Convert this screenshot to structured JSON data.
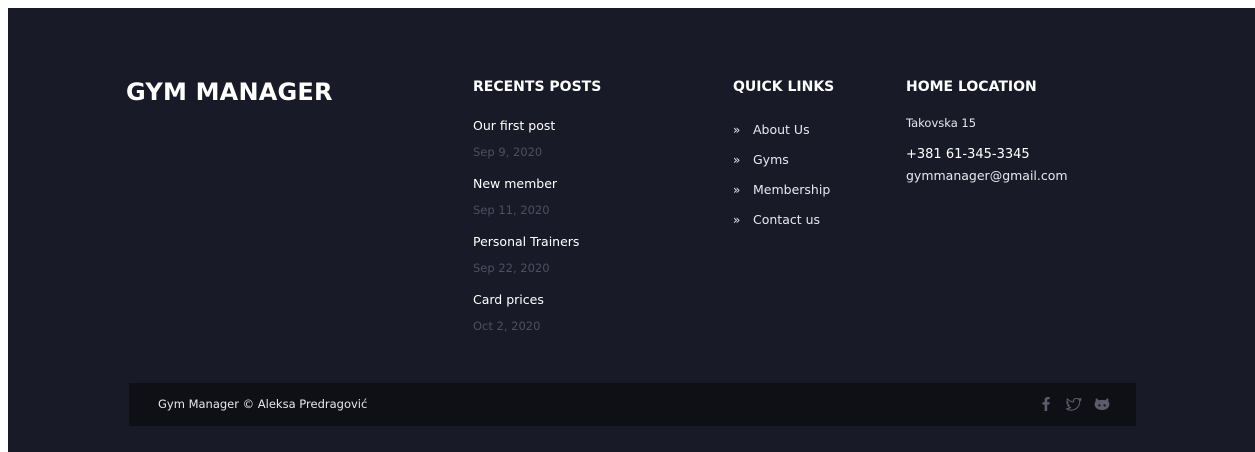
{
  "brand": {
    "title": "GYM MANAGER"
  },
  "recent_posts": {
    "title": "RECENTS POSTS",
    "items": [
      {
        "title": "Our first post",
        "date": "Sep 9, 2020"
      },
      {
        "title": "New member",
        "date": "Sep 11, 2020"
      },
      {
        "title": "Personal Trainers",
        "date": "Sep 22, 2020"
      },
      {
        "title": "Card prices",
        "date": "Oct 2, 2020"
      }
    ]
  },
  "quick_links": {
    "title": "QUICK LINKS",
    "items": [
      {
        "label": "About Us",
        "icon": "double-chevron-right-icon"
      },
      {
        "label": "Gyms",
        "icon": "double-chevron-right-icon"
      },
      {
        "label": "Membership",
        "icon": "double-chevron-right-icon"
      },
      {
        "label": "Contact us",
        "icon": "double-chevron-right-icon"
      }
    ]
  },
  "home_location": {
    "title": "HOME LOCATION",
    "address": "Takovska 15",
    "phone": "+381 61-345-3345",
    "email": "gymmanager@gmail.com"
  },
  "bottom_bar": {
    "copyright": "Gym Manager © Aleksa Predragović",
    "social": [
      {
        "icon": "facebook-icon"
      },
      {
        "icon": "twitter-icon"
      },
      {
        "icon": "github-icon"
      }
    ]
  },
  "colors": {
    "footer_bg": "#191a28",
    "bottom_bar_bg": "#0f0f16",
    "heading": "#ffffff",
    "muted_date": "#4d4f60",
    "social_icon": "#5a5c6b"
  }
}
